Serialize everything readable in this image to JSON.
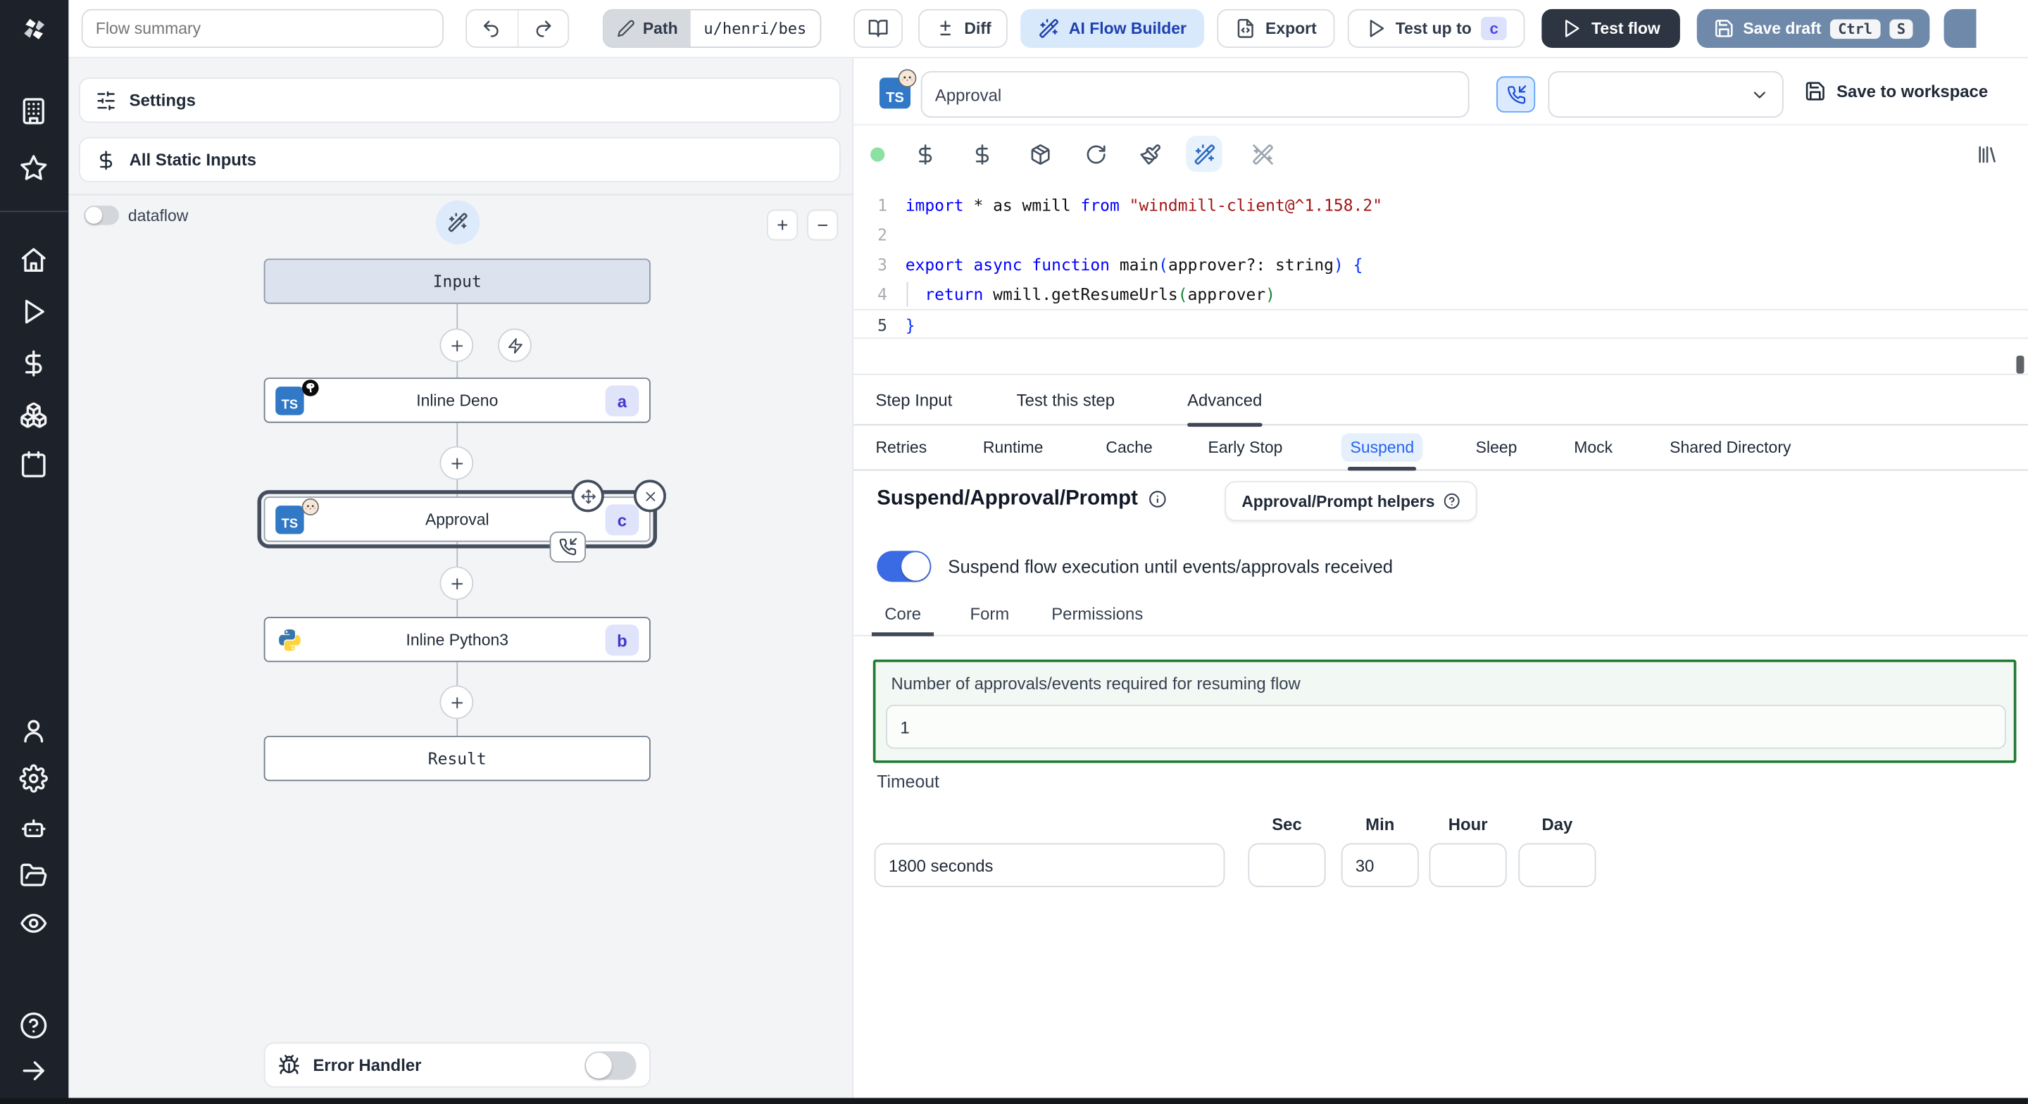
{
  "topbar": {
    "flow_summary_placeholder": "Flow summary",
    "path_label": "Path",
    "path_value": "u/henri/bes",
    "diff_label": "Diff",
    "ai_flow_builder_label": "AI Flow Builder",
    "export_label": "Export",
    "test_up_to_label": "Test up to",
    "test_up_to_badge": "c",
    "test_flow_label": "Test flow",
    "save_draft_label": "Save draft",
    "save_draft_shortcut": [
      "Ctrl",
      "S"
    ]
  },
  "sidebar": {
    "icons": [
      "windmill-logo",
      "building",
      "star",
      "home",
      "play",
      "dollar",
      "boxes",
      "calendar",
      "user",
      "gear",
      "bot",
      "folder-open",
      "eye",
      "help-circle",
      "arrow-right"
    ]
  },
  "left_panel": {
    "settings_label": "Settings",
    "static_inputs_label": "All Static Inputs",
    "dataflow_label": "dataflow",
    "zoom_in_label": "+",
    "zoom_out_label": "−",
    "error_handler_label": "Error Handler",
    "graph": {
      "input_label": "Input",
      "result_label": "Result",
      "nodes": [
        {
          "label": "Inline Deno",
          "badge": "a",
          "language": "deno-typescript"
        },
        {
          "label": "Approval",
          "badge": "c",
          "language": "bun-typescript",
          "selected": true,
          "suspended": true
        },
        {
          "label": "Inline Python3",
          "badge": "b",
          "language": "python3"
        }
      ]
    }
  },
  "step_panel": {
    "step_name": "Approval",
    "save_to_workspace_label": "Save to workspace",
    "tabs": [
      "Step Input",
      "Test this step",
      "Advanced"
    ],
    "active_tab": "Advanced",
    "subtabs": [
      "Retries",
      "Runtime",
      "Cache",
      "Early Stop",
      "Suspend",
      "Sleep",
      "Mock",
      "Shared Directory"
    ],
    "active_subtab": "Suspend",
    "code": {
      "language": "typescript",
      "lines": [
        {
          "num": "1",
          "tokens": [
            [
              "import",
              "kw"
            ],
            [
              " * as wmill ",
              "pl"
            ],
            [
              "from",
              "kw"
            ],
            [
              " ",
              "pl"
            ],
            [
              "\"windmill-client@^1.158.2\"",
              "str"
            ]
          ]
        },
        {
          "num": "2",
          "tokens": []
        },
        {
          "num": "3",
          "tokens": [
            [
              "export",
              "kw"
            ],
            [
              " ",
              "pl"
            ],
            [
              "async",
              "kw"
            ],
            [
              " ",
              "pl"
            ],
            [
              "function",
              "kw"
            ],
            [
              " main",
              "pl"
            ],
            [
              "(",
              "pb"
            ],
            [
              "approver?: string",
              "pl"
            ],
            [
              ")",
              "pb"
            ],
            [
              " {",
              "pb"
            ]
          ]
        },
        {
          "num": "4",
          "tokens": [
            [
              "  ",
              "pl"
            ],
            [
              "return",
              "kw"
            ],
            [
              " wmill.getResumeUrls",
              "pl"
            ],
            [
              "(",
              "pg"
            ],
            [
              "approver",
              "pl"
            ],
            [
              ")",
              "pg"
            ]
          ],
          "indent_guide": true
        },
        {
          "num": "5",
          "tokens": [
            [
              "}",
              "pb"
            ]
          ],
          "active": true
        }
      ]
    },
    "suspend": {
      "title": "Suspend/Approval/Prompt",
      "helpers_button_label": "Approval/Prompt helpers",
      "toggle_label": "Suspend flow execution until events/approvals received",
      "toggle_on": true,
      "tabs": [
        "Core",
        "Form",
        "Permissions"
      ],
      "active_tab": "Core",
      "approvals_label": "Number of approvals/events required for resuming flow",
      "approvals_value": "1",
      "timeout_label": "Timeout",
      "timeout_value": "1800 seconds",
      "unit_labels": [
        "Sec",
        "Min",
        "Hour",
        "Day"
      ],
      "unit_values": [
        "",
        "30",
        "",
        ""
      ]
    }
  },
  "colors": {
    "accent_blue": "#3b82f6",
    "toggle_on": "#3b6be4",
    "save_draft_bg": "#6f89aa",
    "dark_button_bg": "#2d3442",
    "ai_button_bg": "#d8e9fb",
    "node_badge_bg": "#e0e4fb",
    "node_badge_text": "#4338ca",
    "suspend_box_border": "#237a35",
    "code_keyword": "#0000ff",
    "code_string": "#a31515",
    "sidebar_bg": "#1d212a",
    "status_dot": "#8ce0a2"
  }
}
